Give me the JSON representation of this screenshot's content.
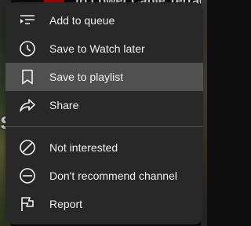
{
  "background": {
    "thumbnail_letter": "s",
    "video_title": "to Lower Cable Terrace"
  },
  "menu": {
    "group_one": [
      {
        "label": "Add to queue",
        "icon": "add-to-queue-icon"
      },
      {
        "label": "Save to Watch later",
        "icon": "clock-icon"
      },
      {
        "label": "Save to playlist",
        "icon": "bookmark-icon"
      },
      {
        "label": "Share",
        "icon": "share-icon"
      }
    ],
    "group_two": [
      {
        "label": "Not interested",
        "icon": "block-icon"
      },
      {
        "label": "Don't recommend channel",
        "icon": "minus-circle-icon"
      },
      {
        "label": "Report",
        "icon": "flag-icon"
      }
    ],
    "highlighted_item": "Save to playlist"
  },
  "colors": {
    "menu_background": "#282828",
    "hover_background": "#505050",
    "text": "#f1f1f1",
    "live_badge": "#cc0000"
  }
}
